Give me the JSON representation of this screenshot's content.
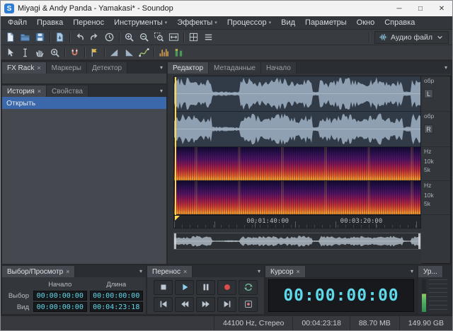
{
  "window": {
    "title": "Miyagi & Andy Panda - Yamakasi* - Soundop",
    "app_initial": "S",
    "minimize_glyph": "─",
    "maximize_glyph": "□",
    "close_glyph": "✕"
  },
  "menu": {
    "items": [
      {
        "name": "file",
        "label": "Файл"
      },
      {
        "name": "edit",
        "label": "Правка"
      },
      {
        "name": "transport",
        "label": "Перенос"
      },
      {
        "name": "tools",
        "label": "Инструменты",
        "arrow": true
      },
      {
        "name": "effects",
        "label": "Эффекты",
        "arrow": true
      },
      {
        "name": "processor",
        "label": "Процессор",
        "arrow": true
      },
      {
        "name": "view",
        "label": "Вид"
      },
      {
        "name": "options",
        "label": "Параметры"
      },
      {
        "name": "window",
        "label": "Окно"
      },
      {
        "name": "help",
        "label": "Справка"
      }
    ]
  },
  "toolbar_main": {
    "icons": [
      "new-file",
      "open-folder",
      "save",
      "|",
      "mixdown",
      "|",
      "undo",
      "redo",
      "history-clock",
      "|",
      "zoom-in",
      "zoom-out",
      "zoom-selection",
      "zoom-all",
      "|",
      "grid",
      "list"
    ],
    "audio_file_label": "Аудио файл"
  },
  "toolbar_edit": {
    "icons": [
      "object-select",
      "time-select",
      "scrub-hand",
      "zoom-in",
      "|",
      "snap-magnet",
      "|",
      "marker-flag",
      "|",
      "fade-in",
      "fade-out",
      "envelope",
      "|",
      "spectrum-bars",
      "level-meter"
    ]
  },
  "fx_panel": {
    "tabs": [
      {
        "name": "fx-rack",
        "label": "FX Rack",
        "active": true,
        "closable": true
      },
      {
        "name": "markers",
        "label": "Маркеры"
      },
      {
        "name": "detector",
        "label": "Детектор"
      }
    ]
  },
  "history_panel": {
    "tabs": [
      {
        "name": "history",
        "label": "История",
        "active": true,
        "closable": true
      },
      {
        "name": "properties",
        "label": "Свойства"
      }
    ],
    "items": [
      {
        "label": "Открыть",
        "selected": true
      }
    ]
  },
  "editor": {
    "tabs": [
      {
        "name": "editor",
        "label": "Редактор",
        "active": true
      },
      {
        "name": "metadata",
        "label": "Метаданные"
      },
      {
        "name": "start",
        "label": "Начало"
      }
    ],
    "ruler": {
      "ch1_unit": "обр",
      "ch1_badge": "L",
      "ch2_unit": "обр",
      "ch2_badge": "R",
      "spec_unit": "Hz",
      "spec_tick_10k": "10k",
      "spec_tick_5k": "5k"
    },
    "timeline": {
      "label1": "00:01:40:00",
      "label2": "00:03:20:00"
    }
  },
  "selection_panel": {
    "title": "Выбор/Просмотр",
    "col_start": "Начало",
    "col_length": "Длина",
    "rows": [
      {
        "label": "Выбор",
        "start": "00:00:00:00",
        "length": "00:00:00:00"
      },
      {
        "label": "Вид",
        "start": "00:00:00:00",
        "length": "00:04:23:18"
      }
    ]
  },
  "transport_panel": {
    "title": "Перенос",
    "row1": [
      "stop",
      "play",
      "pause",
      "record",
      "loop"
    ],
    "row2": [
      "go-start",
      "rewind",
      "fast-forward",
      "go-end",
      "record-arm"
    ]
  },
  "cursor_panel": {
    "title": "Курсор",
    "value": "00:00:00:00"
  },
  "levels_panel": {
    "title": "Ур..."
  },
  "status_bar": {
    "sample_rate": "44100 Hz, Стерео",
    "duration": "00:04:23:18",
    "file_size": "88.70 MB",
    "free_space": "149.90 GB"
  },
  "colors": {
    "accent_cyan": "#5fd8ea",
    "selection_blue": "#3a68ab",
    "playhead_yellow": "#ffd94a",
    "record_red": "#de4b4b",
    "play_blue": "#8fd0ee"
  }
}
